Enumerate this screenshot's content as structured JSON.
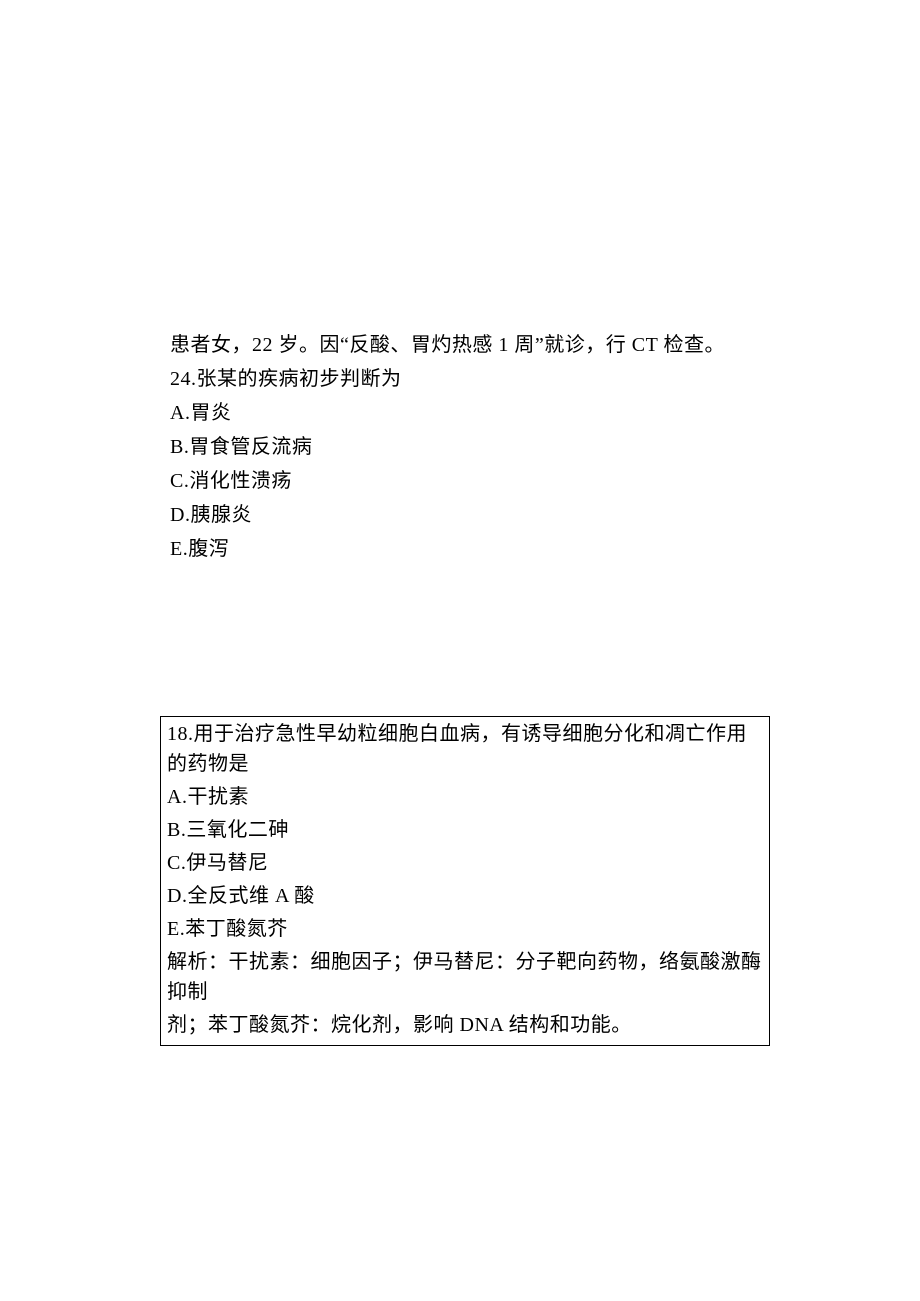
{
  "block1": {
    "line1": "患者女，22 岁。因“反酸、胃灼热感 1 周”就诊，行 CT 检查。",
    "line2": "24.张某的疾病初步判断为",
    "optA": "A.胃炎",
    "optB": "B.胃食管反流病",
    "optC": "C.消化性溃疡",
    "optD": "D.胰腺炎",
    "optE": "E.腹泻"
  },
  "block2": {
    "line1": "18.用于治疗急性早幼粒细胞白血病，有诱导细胞分化和凋亡作用的药物是",
    "optA": "A.干扰素",
    "optB": "B.三氧化二砷",
    "optC": "C.伊马替尼",
    "optD": "D.全反式维 A 酸",
    "optE": "E.苯丁酸氮芥",
    "expl1": "解析：干扰素：细胞因子；伊马替尼：分子靶向药物，络氨酸激酶抑制",
    "expl2": "剂；苯丁酸氮芥：烷化剂，影响 DNA 结构和功能。"
  }
}
